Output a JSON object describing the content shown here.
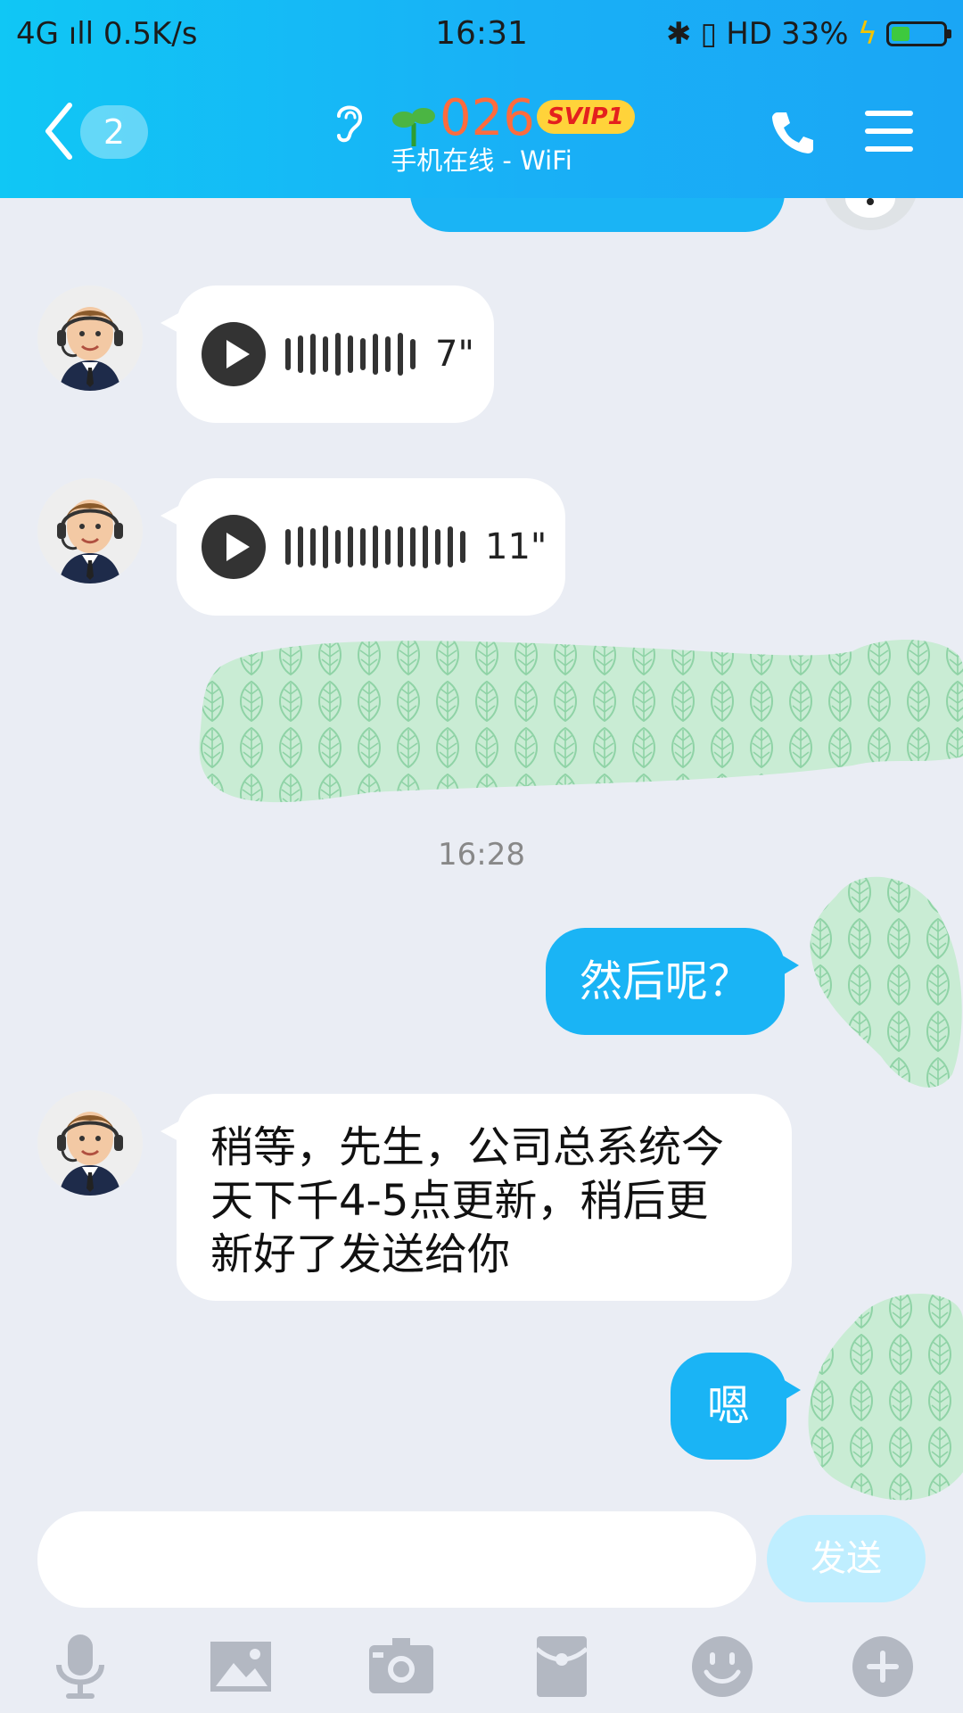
{
  "status_bar": {
    "left": "4G ıll 0.5K/s",
    "time": "16:31",
    "right_text": "HD",
    "battery": "33%"
  },
  "header": {
    "unread_count": "2",
    "contact_name": "026",
    "badge": "SVIP1",
    "presence": "手机在线 - WiFi"
  },
  "messages": [
    {
      "type": "voice",
      "direction": "in",
      "duration": "7\""
    },
    {
      "type": "voice",
      "direction": "in",
      "duration": "11\""
    },
    {
      "type": "redacted",
      "direction": "out"
    },
    {
      "type": "timestamp",
      "text": "16:28"
    },
    {
      "type": "text",
      "direction": "out",
      "text": "然后呢？"
    },
    {
      "type": "text",
      "direction": "in",
      "lines": [
        "稍等，先生，公司总系统今",
        "天下千4-5点更新，稍后更",
        "新好了发送给你"
      ]
    },
    {
      "type": "text",
      "direction": "out",
      "text": "嗯"
    }
  ],
  "input": {
    "placeholder": "",
    "send_label": "发送"
  },
  "toolbar": [
    "microphone-icon",
    "image-icon",
    "camera-icon",
    "red-packet-icon",
    "emoji-icon",
    "plus-icon"
  ],
  "colors": {
    "header_gradient": "#10c7f5",
    "outgoing_bubble": "#1ab4f5",
    "incoming_bubble": "#ffffff",
    "background": "#eaedf4",
    "send_disabled": "#bfeeff",
    "svip_badge": "#ffd33a"
  }
}
